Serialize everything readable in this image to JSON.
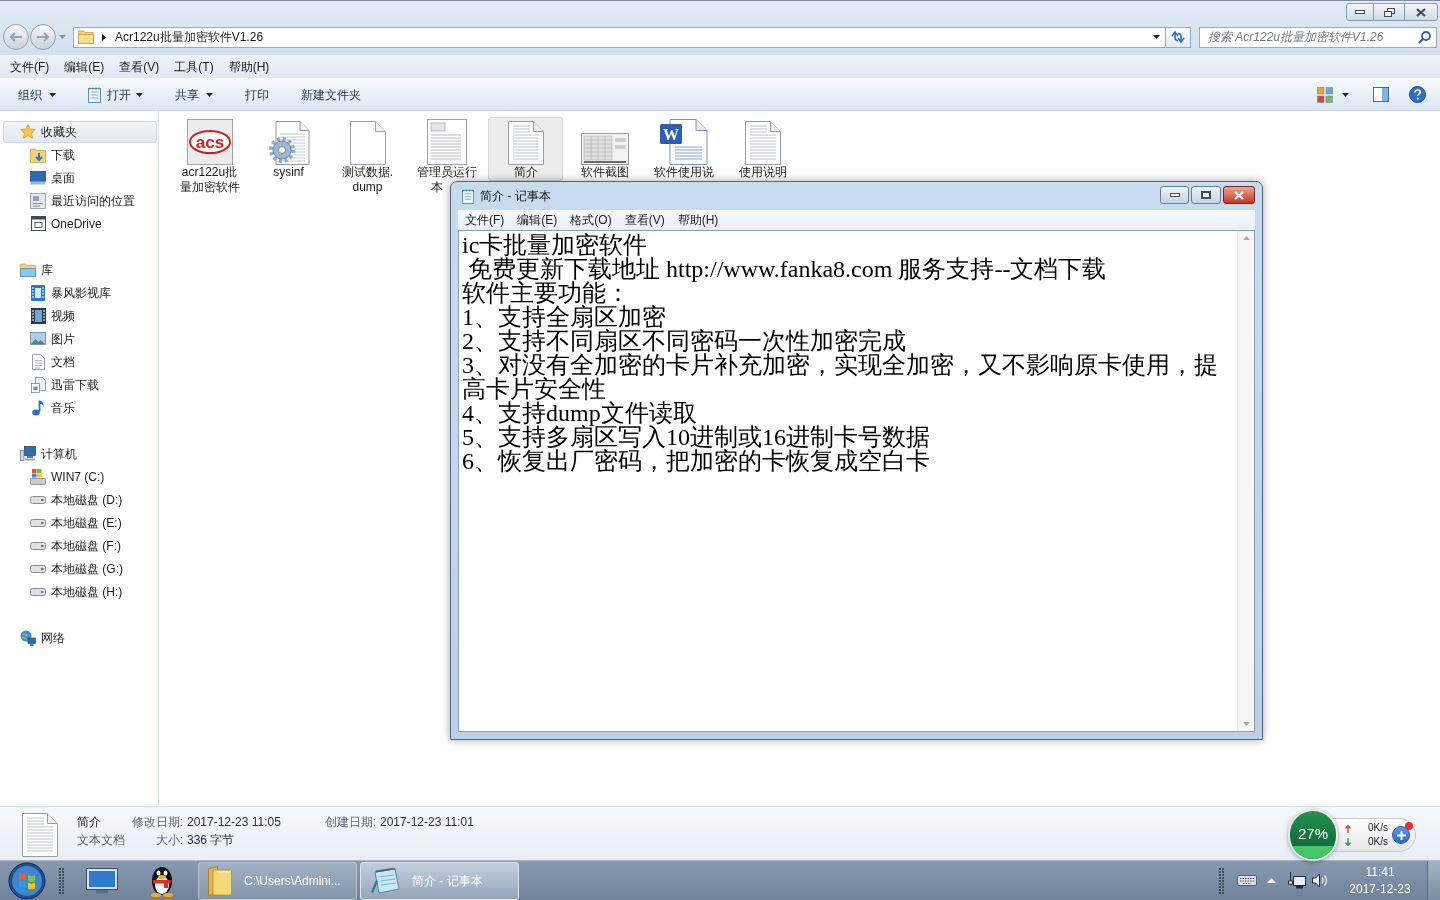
{
  "explorer": {
    "address": {
      "path": "Acr122u批量加密软件V1.26"
    },
    "search": {
      "placeholder": "搜索 Acr122u批量加密软件V1.26"
    },
    "menu": [
      "文件(F)",
      "编辑(E)",
      "查看(V)",
      "工具(T)",
      "帮助(H)"
    ],
    "toolbar": [
      {
        "label": "组织",
        "kind": "menu"
      },
      {
        "label": "打开",
        "kind": "open"
      },
      {
        "label": "共享",
        "kind": "menu"
      },
      {
        "label": "打印",
        "kind": "action"
      },
      {
        "label": "新建文件夹",
        "kind": "action"
      }
    ],
    "sidebar": {
      "groups": [
        {
          "label": "收藏夹",
          "selected": true,
          "children": [
            {
              "label": "下载"
            },
            {
              "label": "桌面"
            },
            {
              "label": "最近访问的位置"
            },
            {
              "label": "OneDrive"
            }
          ]
        },
        {
          "label": "库",
          "selected": false,
          "children": [
            {
              "label": "暴风影视库"
            },
            {
              "label": "视频"
            },
            {
              "label": "图片"
            },
            {
              "label": "文档"
            },
            {
              "label": "迅雷下载"
            },
            {
              "label": "音乐"
            }
          ]
        },
        {
          "label": "计算机",
          "selected": false,
          "children": [
            {
              "label": "WIN7 (C:)"
            },
            {
              "label": "本地磁盘 (D:)"
            },
            {
              "label": "本地磁盘 (E:)"
            },
            {
              "label": "本地磁盘 (F:)"
            },
            {
              "label": "本地磁盘 (G:)"
            },
            {
              "label": "本地磁盘 (H:)"
            }
          ]
        },
        {
          "label": "网络",
          "selected": false
        }
      ]
    },
    "files": [
      {
        "lines": [
          "acr122u批",
          "量加密软件"
        ],
        "icon_text": "acs",
        "selected": false,
        "label_cut": false
      },
      {
        "lines": [
          "sysinf"
        ],
        "selected": false,
        "label_cut": false
      },
      {
        "lines": [
          "测试数据.",
          "dump"
        ],
        "selected": false,
        "label_cut": false
      },
      {
        "lines": [
          "管理员运行",
          "本"
        ],
        "selected": false,
        "label_cut": true
      },
      {
        "lines": [
          "简介"
        ],
        "selected": true,
        "label_cut": false
      },
      {
        "lines": [
          "软件截图"
        ],
        "selected": false,
        "label_cut": false
      },
      {
        "lines": [
          "软件使用说"
        ],
        "icon_text": "W",
        "selected": false,
        "label_cut": false
      },
      {
        "lines": [
          "使用说明"
        ],
        "selected": false,
        "label_cut": false
      }
    ],
    "details": {
      "name": "简介",
      "type": "文本文档",
      "fields": [
        {
          "label": "修改日期:",
          "value": "2017-12-23 11:05"
        },
        {
          "label": "大小:",
          "value": "336 字节"
        },
        {
          "label": "创建日期:",
          "value": "2017-12-23 11:01"
        }
      ]
    }
  },
  "notepad": {
    "title": "简介 - 记事本",
    "menu": [
      "文件(F)",
      "编辑(E)",
      "格式(O)",
      "查看(V)",
      "帮助(H)"
    ],
    "lines": [
      "ic卡批量加密软件",
      " 免费更新下载地址 http://www.fanka8.com 服务支持--文档下载",
      "软件主要功能：",
      "1、支持全扇区加密",
      "2、支持不同扇区不同密码一次性加密完成",
      "3、对没有全加密的卡片补充加密，实现全加密，又不影响原卡使用，提高卡片安全性",
      "4、支持dump文件读取",
      "5、支持多扇区写入10进制或16进制卡号数据",
      "6、恢复出厂密码，把加密的卡恢复成空白卡"
    ]
  },
  "net_widget": {
    "percent": "27%",
    "level": 0.27,
    "upload": "0K/s",
    "download": "0K/s"
  },
  "taskbar": {
    "tasks": [
      {
        "label": "C:\\Users\\Admini...",
        "selected": false
      },
      {
        "label": "简介 - 记事本",
        "selected": true
      }
    ],
    "clock": {
      "time": "11:41",
      "date": "2017-12-23"
    }
  }
}
